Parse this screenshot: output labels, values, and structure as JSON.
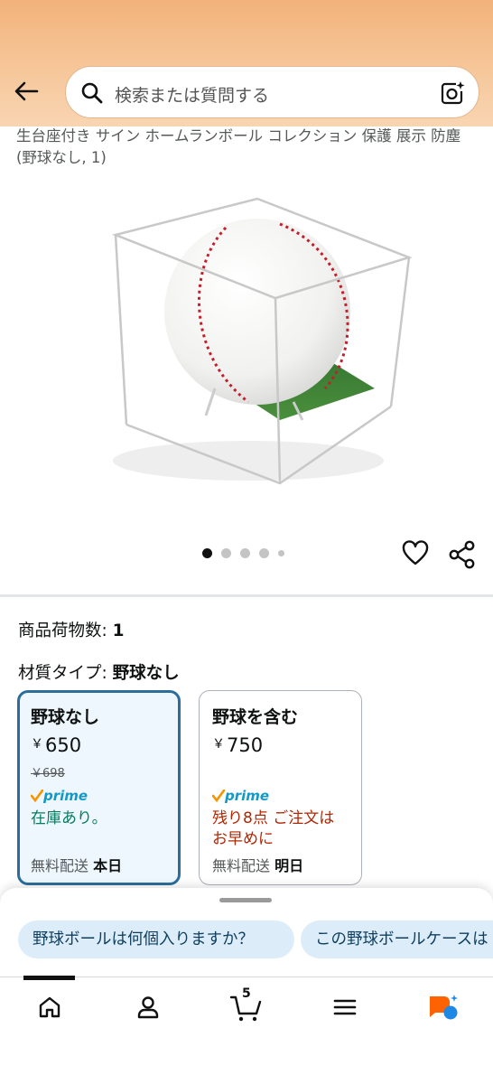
{
  "header": {
    "search_placeholder": "検索または質問する",
    "icons": {
      "back": "arrow-left-icon",
      "search": "search-icon",
      "camera": "camera-lens-icon"
    }
  },
  "product": {
    "title": "生台座付き サイン ホームランボール コレクション 保護 展示 防塵 (野球なし, 1)",
    "image_alt": "ball-in-acrylic-cube-image",
    "image_count": 5,
    "active_image": 0
  },
  "details": {
    "quantity_label": "商品荷物数: ",
    "quantity_value": "1",
    "material_label": "材質タイプ: ",
    "material_value": "野球なし"
  },
  "variants": [
    {
      "name": "野球なし",
      "price": "650",
      "currency": "￥",
      "list_price": "￥698",
      "prime": "prime",
      "stock": "在庫あり。",
      "delivery_label": "無料配送 ",
      "delivery_when": "本日",
      "selected": true
    },
    {
      "name": "野球を含む",
      "price": "750",
      "currency": "￥",
      "prime": "prime",
      "stock_line1": "残り8点 ご注文は",
      "stock_line2": "お早めに",
      "delivery_label": "無料配送 ",
      "delivery_when": "明日",
      "selected": false
    }
  ],
  "suggestions": [
    "野球ボールは何個入りますか？",
    "この野球ボールケースは"
  ],
  "bottom_nav": {
    "items": [
      "home-icon",
      "account-icon",
      "cart-icon",
      "menu-icon",
      "rufus-icon"
    ],
    "cart_count": "5"
  },
  "colors": {
    "header_orange": "#f2b27a",
    "selected_border": "#2c6e99",
    "selected_bg": "#edf7fd",
    "in_stock": "#067d62",
    "low_stock": "#b12704",
    "prime_blue": "#1399c6",
    "prime_check": "#f79400",
    "chip_bg": "#dcedf9",
    "rufus_orange": "#ff6200",
    "rufus_blue": "#1e88e5"
  }
}
